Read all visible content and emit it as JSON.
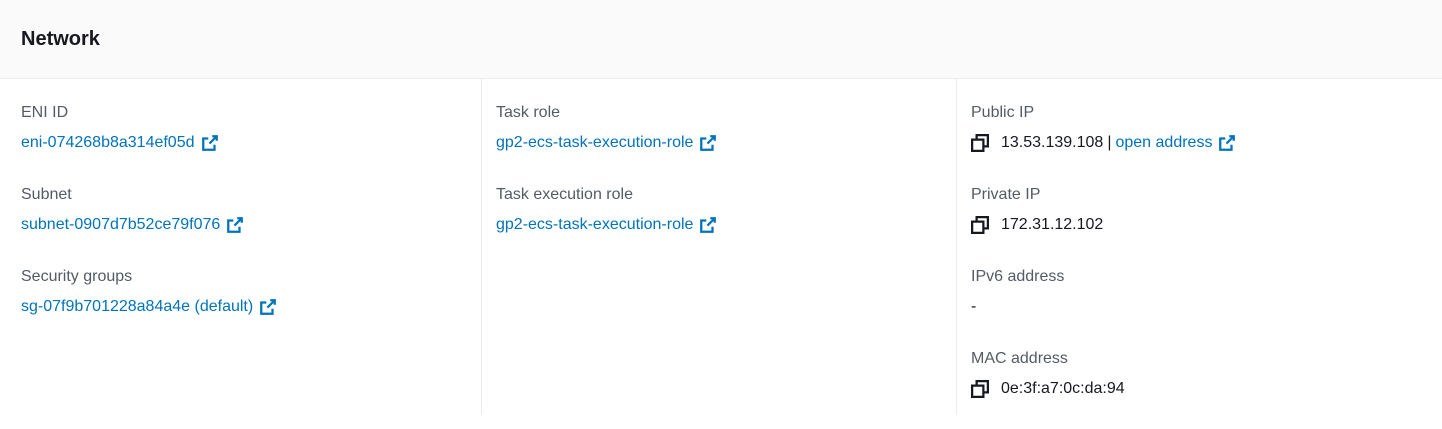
{
  "panel": {
    "title": "Network"
  },
  "col1": {
    "eni": {
      "label": "ENI ID",
      "value": "eni-074268b8a314ef05d"
    },
    "subnet": {
      "label": "Subnet",
      "value": "subnet-0907d7b52ce79f076"
    },
    "security_groups": {
      "label": "Security groups",
      "value": "sg-07f9b701228a84a4e (default)"
    }
  },
  "col2": {
    "task_role": {
      "label": "Task role",
      "value": "gp2-ecs-task-execution-role"
    },
    "task_execution_role": {
      "label": "Task execution role",
      "value": "gp2-ecs-task-execution-role"
    }
  },
  "col3": {
    "public_ip": {
      "label": "Public IP",
      "value": "13.53.139.108",
      "separator": "|",
      "link": "open address"
    },
    "private_ip": {
      "label": "Private IP",
      "value": "172.31.12.102"
    },
    "ipv6": {
      "label": "IPv6 address",
      "value": "-"
    },
    "mac": {
      "label": "MAC address",
      "value": "0e:3f:a7:0c:da:94"
    }
  },
  "icons": {
    "external": "external-link-icon",
    "copy": "copy-icon"
  },
  "colors": {
    "link": "#0073bb",
    "label": "#545b64",
    "text": "#16191f",
    "header_bg": "#fafafa",
    "divider": "#eaeded"
  }
}
